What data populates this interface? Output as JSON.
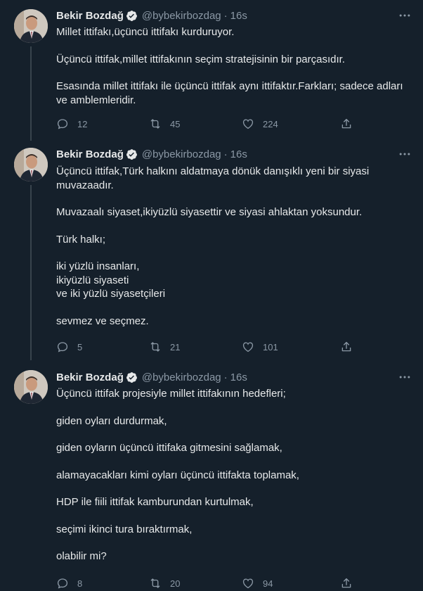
{
  "tweets": [
    {
      "name": "Bekir Bozdağ",
      "handle": "@bybekirbozdag",
      "dot": "·",
      "time": "16s",
      "paragraphs": [
        "Millet ittifakı,üçüncü ittifakı kurduruyor.",
        "Üçüncü ittifak,millet ittifakının seçim stratejisinin bir parçasıdır.",
        "Esasında millet ittifakı ile üçüncü ittifak aynı ittifaktır.Farkları; sadece adları ve amblemleridir."
      ],
      "replies": "12",
      "retweets": "45",
      "likes": "224"
    },
    {
      "name": "Bekir Bozdağ",
      "handle": "@bybekirbozdag",
      "dot": "·",
      "time": "16s",
      "paragraphs": [
        "Üçüncü ittifak,Türk halkını aldatmaya dönük danışıklı yeni bir siyasi muvazaadır.",
        "Muvazaalı siyaset,ikiyüzlü siyasettir ve siyasi ahlaktan yoksundur.",
        "Türk halkı;",
        "iki yüzlü insanları,\nikiyüzlü siyaseti\nve iki yüzlü siyasetçileri",
        "sevmez ve seçmez."
      ],
      "replies": "5",
      "retweets": "21",
      "likes": "101"
    },
    {
      "name": "Bekir Bozdağ",
      "handle": "@bybekirbozdag",
      "dot": "·",
      "time": "16s",
      "paragraphs": [
        "Üçüncü ittifak projesiyle millet ittifakının hedefleri;",
        "giden oyları durdurmak,",
        "giden oyların üçüncü ittifaka gitmesini sağlamak,",
        "alamayacakları kimi oyları üçüncü ittifakta toplamak,",
        "HDP ile fiili ittifak kamburundan kurtulmak,",
        "seçimi ikinci tura bıraktırmak,",
        "olabilir mi?"
      ],
      "replies": "8",
      "retweets": "20",
      "likes": "94"
    }
  ],
  "colors": {
    "background": "#15202b",
    "text": "#e7e9ea",
    "muted": "#8b98a5",
    "verified": "#1d9bf0",
    "thread_line": "#38444d"
  },
  "icons": [
    "verified-badge-icon",
    "more-icon",
    "reply-icon",
    "retweet-icon",
    "like-icon",
    "share-icon"
  ]
}
